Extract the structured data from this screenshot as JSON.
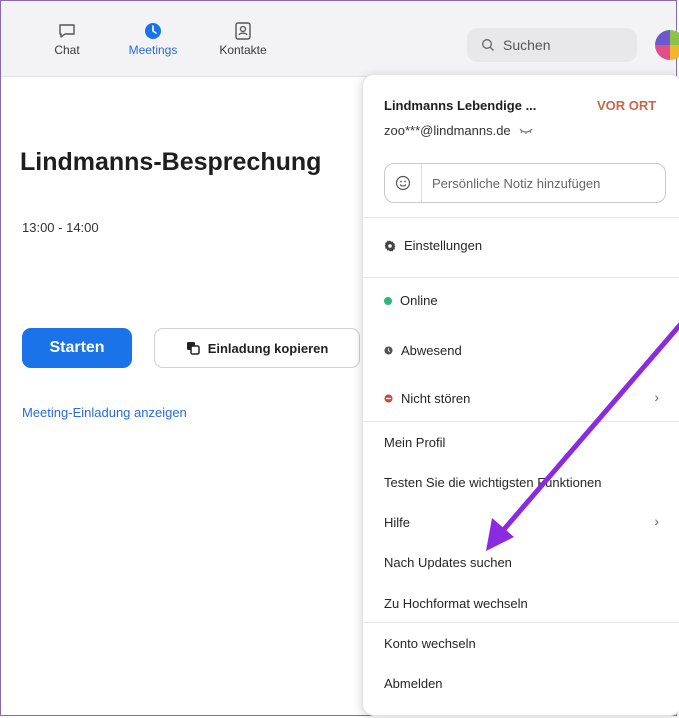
{
  "tabs": [
    {
      "label": "Chat",
      "icon": "chat-icon"
    },
    {
      "label": "Meetings",
      "icon": "clock-icon",
      "active": true
    },
    {
      "label": "Kontakte",
      "icon": "contacts-icon"
    }
  ],
  "search": {
    "placeholder": "Suchen"
  },
  "meeting": {
    "title": "Lindmanns-Besprechung",
    "time": "13:00 - 14:00",
    "start_label": "Starten",
    "copy_label": "Einladung kopieren",
    "show_invite": "Meeting-Einladung anzeigen"
  },
  "menu": {
    "name": "Lindmanns Lebendige ...",
    "location": "VOR ORT",
    "email": "zoo***@lindmanns.de",
    "note_placeholder": "Persönliche Notiz hinzufügen",
    "settings": "Einstellungen",
    "status": {
      "online": "Online",
      "away": "Abwesend",
      "dnd": "Nicht stören"
    },
    "profile": "Mein Profil",
    "features": "Testen Sie die wichtigsten Funktionen",
    "help": "Hilfe",
    "updates": "Nach Updates suchen",
    "portrait": "Zu Hochformat wechseln",
    "switch_account": "Konto wechseln",
    "logout": "Abmelden"
  },
  "colors": {
    "accent": "#1a73e8",
    "online": "#2eb67d",
    "dnd": "#e0403a",
    "location": "#c4674a",
    "arrow": "#8a2be2"
  }
}
